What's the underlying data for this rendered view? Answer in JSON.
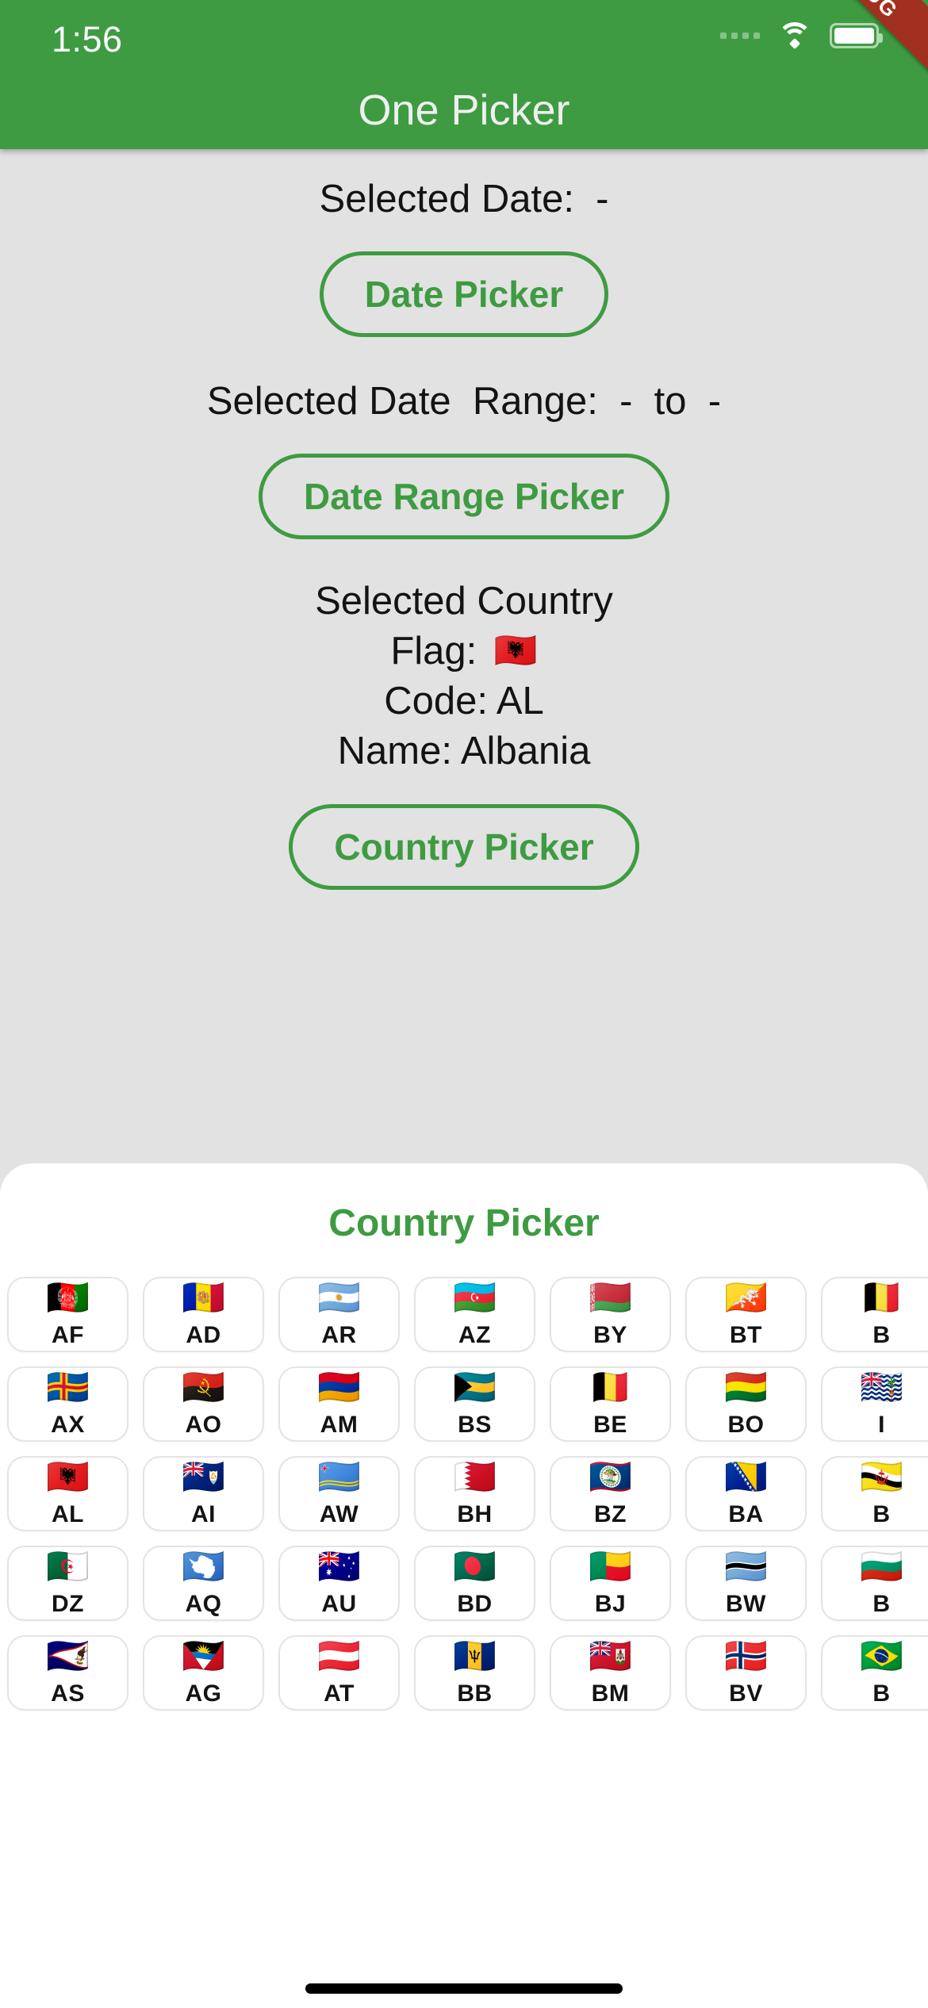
{
  "status_bar": {
    "time": "1:56",
    "signal_icon": "signal-dots-icon",
    "wifi_icon": "wifi-icon",
    "battery_icon": "battery-icon"
  },
  "debug_banner": {
    "label": "DEBUG"
  },
  "app_bar": {
    "title": "One Picker"
  },
  "theme": {
    "primary_green": "#3E9B41",
    "body_background": "#E2E2E2",
    "sheet_background": "#FFFFFF",
    "debug_red": "#A2301E",
    "text_dark": "#131313"
  },
  "date_section": {
    "label": "Selected Date:  -",
    "button_label": "Date Picker"
  },
  "date_range_section": {
    "label": "Selected Date  Range:  -  to  -",
    "button_label": "Date Range Picker"
  },
  "country_section": {
    "heading": "Selected Country",
    "flag_label": "Flag: ",
    "flag_emoji": "🇦🇱",
    "code_label": "Code: AL",
    "name_label": "Name: Albania",
    "button_label": "Country Picker"
  },
  "country_sheet": {
    "title": "Country Picker",
    "columns": 7,
    "items": [
      {
        "flag": "🇦🇫",
        "code": "AF"
      },
      {
        "flag": "🇦🇩",
        "code": "AD"
      },
      {
        "flag": "🇦🇷",
        "code": "AR"
      },
      {
        "flag": "🇦🇿",
        "code": "AZ"
      },
      {
        "flag": "🇧🇾",
        "code": "BY"
      },
      {
        "flag": "🇧🇹",
        "code": "BT"
      },
      {
        "flag": "🇧🇪",
        "code": "B"
      },
      {
        "flag": "🇦🇽",
        "code": "AX"
      },
      {
        "flag": "🇦🇴",
        "code": "AO"
      },
      {
        "flag": "🇦🇲",
        "code": "AM"
      },
      {
        "flag": "🇧🇸",
        "code": "BS"
      },
      {
        "flag": "🇧🇪",
        "code": "BE"
      },
      {
        "flag": "🇧🇴",
        "code": "BO"
      },
      {
        "flag": "🇮🇴",
        "code": "I"
      },
      {
        "flag": "🇦🇱",
        "code": "AL"
      },
      {
        "flag": "🇦🇮",
        "code": "AI"
      },
      {
        "flag": "🇦🇼",
        "code": "AW"
      },
      {
        "flag": "🇧🇭",
        "code": "BH"
      },
      {
        "flag": "🇧🇿",
        "code": "BZ"
      },
      {
        "flag": "🇧🇦",
        "code": "BA"
      },
      {
        "flag": "🇧🇳",
        "code": "B"
      },
      {
        "flag": "🇩🇿",
        "code": "DZ"
      },
      {
        "flag": "🇦🇶",
        "code": "AQ"
      },
      {
        "flag": "🇦🇺",
        "code": "AU"
      },
      {
        "flag": "🇧🇩",
        "code": "BD"
      },
      {
        "flag": "🇧🇯",
        "code": "BJ"
      },
      {
        "flag": "🇧🇼",
        "code": "BW"
      },
      {
        "flag": "🇧🇬",
        "code": "B"
      },
      {
        "flag": "🇦🇸",
        "code": "AS"
      },
      {
        "flag": "🇦🇬",
        "code": "AG"
      },
      {
        "flag": "🇦🇹",
        "code": "AT"
      },
      {
        "flag": "🇧🇧",
        "code": "BB"
      },
      {
        "flag": "🇧🇲",
        "code": "BM"
      },
      {
        "flag": "🇧🇻",
        "code": "BV"
      },
      {
        "flag": "🇧🇷",
        "code": "B"
      }
    ]
  }
}
